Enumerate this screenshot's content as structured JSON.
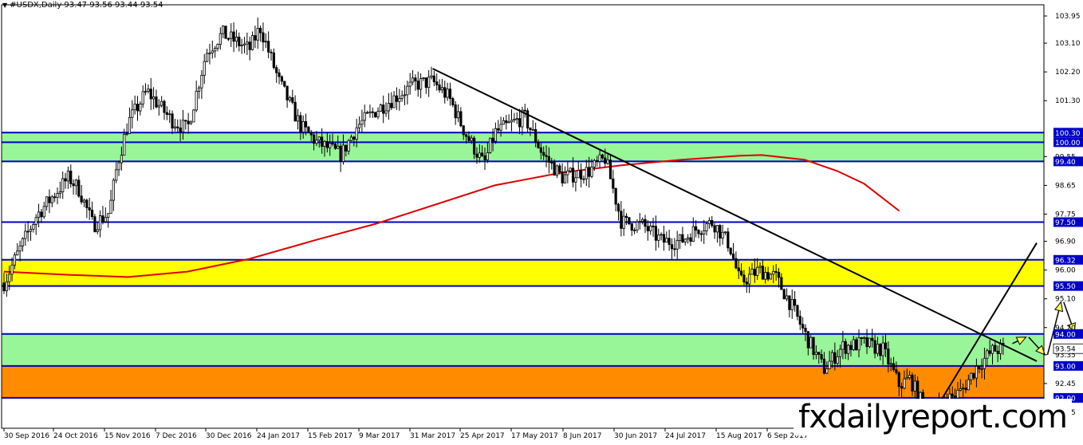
{
  "header": {
    "symbol_line": "#USDX,Daily  93.47 93.56 93.44 93.54"
  },
  "watermark": "fxdailyreport.com",
  "colors": {
    "green_zone": "#98f598",
    "yellow_zone": "#ffff00",
    "orange_zone": "#ff8c00",
    "level_line": "#0000c8",
    "moving_average": "#e00000",
    "trend_line": "#000000",
    "candles": "#000000",
    "arrow": "#ffff55"
  },
  "chart_data": {
    "type": "candlestick",
    "title": "#USDX,Daily",
    "ohlc_last": {
      "open": 93.47,
      "high": 93.56,
      "low": 93.44,
      "close": 93.54
    },
    "y_range": [
      91.05,
      104.3
    ],
    "y_ticks": [
      103.95,
      103.1,
      102.2,
      101.3,
      99.55,
      98.65,
      97.75,
      96.9,
      96.0,
      95.1,
      94.2,
      93.35,
      92.45,
      91.55
    ],
    "x_start": "2016-09-30",
    "x_end": "2017-10-18",
    "x_ticks": [
      "30 Sep 2016",
      "24 Oct 2016",
      "15 Nov 2016",
      "7 Dec 2016",
      "30 Dec 2016",
      "24 Jan 2017",
      "15 Feb 2017",
      "9 Mar 2017",
      "31 Mar 2017",
      "25 Apr 2017",
      "17 May 2017",
      "8 Jun 2017",
      "30 Jun 2017",
      "24 Jul 2017",
      "15 Aug 2017",
      "6 Sep 2017"
    ],
    "horizontal_levels": [
      {
        "value": 100.3,
        "label": "100.30"
      },
      {
        "value": 100.0,
        "label": "100.00"
      },
      {
        "value": 99.4,
        "label": "99.40"
      },
      {
        "value": 97.5,
        "label": "97.50"
      },
      {
        "value": 96.32,
        "label": "96.32"
      },
      {
        "value": 95.5,
        "label": "95.50"
      },
      {
        "value": 94.0,
        "label": "94.00"
      },
      {
        "value": 93.0,
        "label": "93.00"
      },
      {
        "value": 92.0,
        "label": "92.00"
      }
    ],
    "price_tag": {
      "value": 93.54,
      "label": "93.54"
    },
    "zones": [
      {
        "from": 99.4,
        "to": 100.3,
        "color": "green"
      },
      {
        "from": 95.5,
        "to": 96.32,
        "color": "yellow"
      },
      {
        "from": 93.0,
        "to": 94.0,
        "color": "green"
      },
      {
        "from": 92.0,
        "to": 93.0,
        "color": "orange"
      }
    ],
    "trend_lines": [
      {
        "from": {
          "date": "2017-03-08",
          "price": 102.3
        },
        "to": {
          "date": "2017-10-18",
          "price": 93.15
        }
      },
      {
        "from": {
          "date": "2017-09-08",
          "price": 91.3
        },
        "to": {
          "date": "2017-10-18",
          "price": 96.85
        }
      }
    ],
    "moving_average": [
      {
        "date": "2016-09-30",
        "price": 95.95
      },
      {
        "date": "2016-10-24",
        "price": 95.85
      },
      {
        "date": "2016-11-15",
        "price": 95.78
      },
      {
        "date": "2016-12-07",
        "price": 95.95
      },
      {
        "date": "2016-12-30",
        "price": 96.35
      },
      {
        "date": "2017-01-24",
        "price": 96.95
      },
      {
        "date": "2017-02-15",
        "price": 97.45
      },
      {
        "date": "2017-03-09",
        "price": 98.05
      },
      {
        "date": "2017-03-31",
        "price": 98.65
      },
      {
        "date": "2017-04-25",
        "price": 99.05
      },
      {
        "date": "2017-05-17",
        "price": 99.28
      },
      {
        "date": "2017-06-08",
        "price": 99.45
      },
      {
        "date": "2017-06-30",
        "price": 99.58
      },
      {
        "date": "2017-07-08",
        "price": 99.6
      },
      {
        "date": "2017-07-24",
        "price": 99.45
      },
      {
        "date": "2017-08-05",
        "price": 99.1
      },
      {
        "date": "2017-08-15",
        "price": 98.7
      },
      {
        "date": "2017-08-28",
        "price": 97.85
      }
    ],
    "price_path": [
      {
        "date": "2016-09-30",
        "price": 95.6
      },
      {
        "date": "2016-10-05",
        "price": 96.5
      },
      {
        "date": "2016-10-12",
        "price": 97.7
      },
      {
        "date": "2016-10-20",
        "price": 98.5
      },
      {
        "date": "2016-10-24",
        "price": 98.9
      },
      {
        "date": "2016-10-28",
        "price": 98.5
      },
      {
        "date": "2016-11-02",
        "price": 97.4
      },
      {
        "date": "2016-11-08",
        "price": 97.8
      },
      {
        "date": "2016-11-11",
        "price": 99.3
      },
      {
        "date": "2016-11-15",
        "price": 100.6
      },
      {
        "date": "2016-11-22",
        "price": 101.6
      },
      {
        "date": "2016-12-01",
        "price": 100.7
      },
      {
        "date": "2016-12-07",
        "price": 100.4
      },
      {
        "date": "2016-12-14",
        "price": 102.8
      },
      {
        "date": "2016-12-20",
        "price": 103.4
      },
      {
        "date": "2016-12-30",
        "price": 102.9
      },
      {
        "date": "2017-01-03",
        "price": 103.6
      },
      {
        "date": "2017-01-10",
        "price": 101.9
      },
      {
        "date": "2017-01-18",
        "price": 100.5
      },
      {
        "date": "2017-01-24",
        "price": 100.0
      },
      {
        "date": "2017-02-02",
        "price": 99.6
      },
      {
        "date": "2017-02-08",
        "price": 100.5
      },
      {
        "date": "2017-02-15",
        "price": 101.0
      },
      {
        "date": "2017-02-22",
        "price": 101.4
      },
      {
        "date": "2017-03-01",
        "price": 101.8
      },
      {
        "date": "2017-03-08",
        "price": 101.9
      },
      {
        "date": "2017-03-14",
        "price": 101.4
      },
      {
        "date": "2017-03-20",
        "price": 100.3
      },
      {
        "date": "2017-03-27",
        "price": 99.3
      },
      {
        "date": "2017-03-31",
        "price": 100.3
      },
      {
        "date": "2017-04-11",
        "price": 100.8
      },
      {
        "date": "2017-04-18",
        "price": 99.6
      },
      {
        "date": "2017-04-25",
        "price": 98.9
      },
      {
        "date": "2017-05-05",
        "price": 99.1
      },
      {
        "date": "2017-05-11",
        "price": 99.5
      },
      {
        "date": "2017-05-17",
        "price": 97.5
      },
      {
        "date": "2017-05-25",
        "price": 97.4
      },
      {
        "date": "2017-06-01",
        "price": 96.9
      },
      {
        "date": "2017-06-08",
        "price": 96.9
      },
      {
        "date": "2017-06-14",
        "price": 97.3
      },
      {
        "date": "2017-06-20",
        "price": 97.5
      },
      {
        "date": "2017-06-26",
        "price": 96.8
      },
      {
        "date": "2017-06-30",
        "price": 95.6
      },
      {
        "date": "2017-07-07",
        "price": 96.0
      },
      {
        "date": "2017-07-13",
        "price": 95.8
      },
      {
        "date": "2017-07-19",
        "price": 94.9
      },
      {
        "date": "2017-07-24",
        "price": 94.0
      },
      {
        "date": "2017-07-31",
        "price": 92.9
      },
      {
        "date": "2017-08-07",
        "price": 93.6
      },
      {
        "date": "2017-08-15",
        "price": 93.7
      },
      {
        "date": "2017-08-22",
        "price": 93.5
      },
      {
        "date": "2017-08-28",
        "price": 92.4
      },
      {
        "date": "2017-09-01",
        "price": 92.6
      },
      {
        "date": "2017-09-08",
        "price": 91.4
      },
      {
        "date": "2017-09-14",
        "price": 91.9
      },
      {
        "date": "2017-09-20",
        "price": 92.2
      },
      {
        "date": "2017-09-26",
        "price": 93.0
      },
      {
        "date": "2017-10-02",
        "price": 93.5
      },
      {
        "date": "2017-10-06",
        "price": 93.54
      }
    ],
    "forecast_arrows": [
      {
        "from": {
          "date": "2017-10-09",
          "price": 93.7
        },
        "to": {
          "date": "2017-10-14",
          "price": 93.9
        }
      },
      {
        "from": {
          "date": "2017-10-15",
          "price": 93.9
        },
        "to": {
          "date": "2017-10-21",
          "price": 93.35
        }
      },
      {
        "from": {
          "date": "2017-10-22",
          "price": 93.35
        },
        "to": {
          "date": "2017-10-27",
          "price": 95.0
        }
      },
      {
        "from": {
          "date": "2017-10-28",
          "price": 95.0
        },
        "to": {
          "date": "2017-11-01",
          "price": 94.05
        }
      }
    ]
  }
}
